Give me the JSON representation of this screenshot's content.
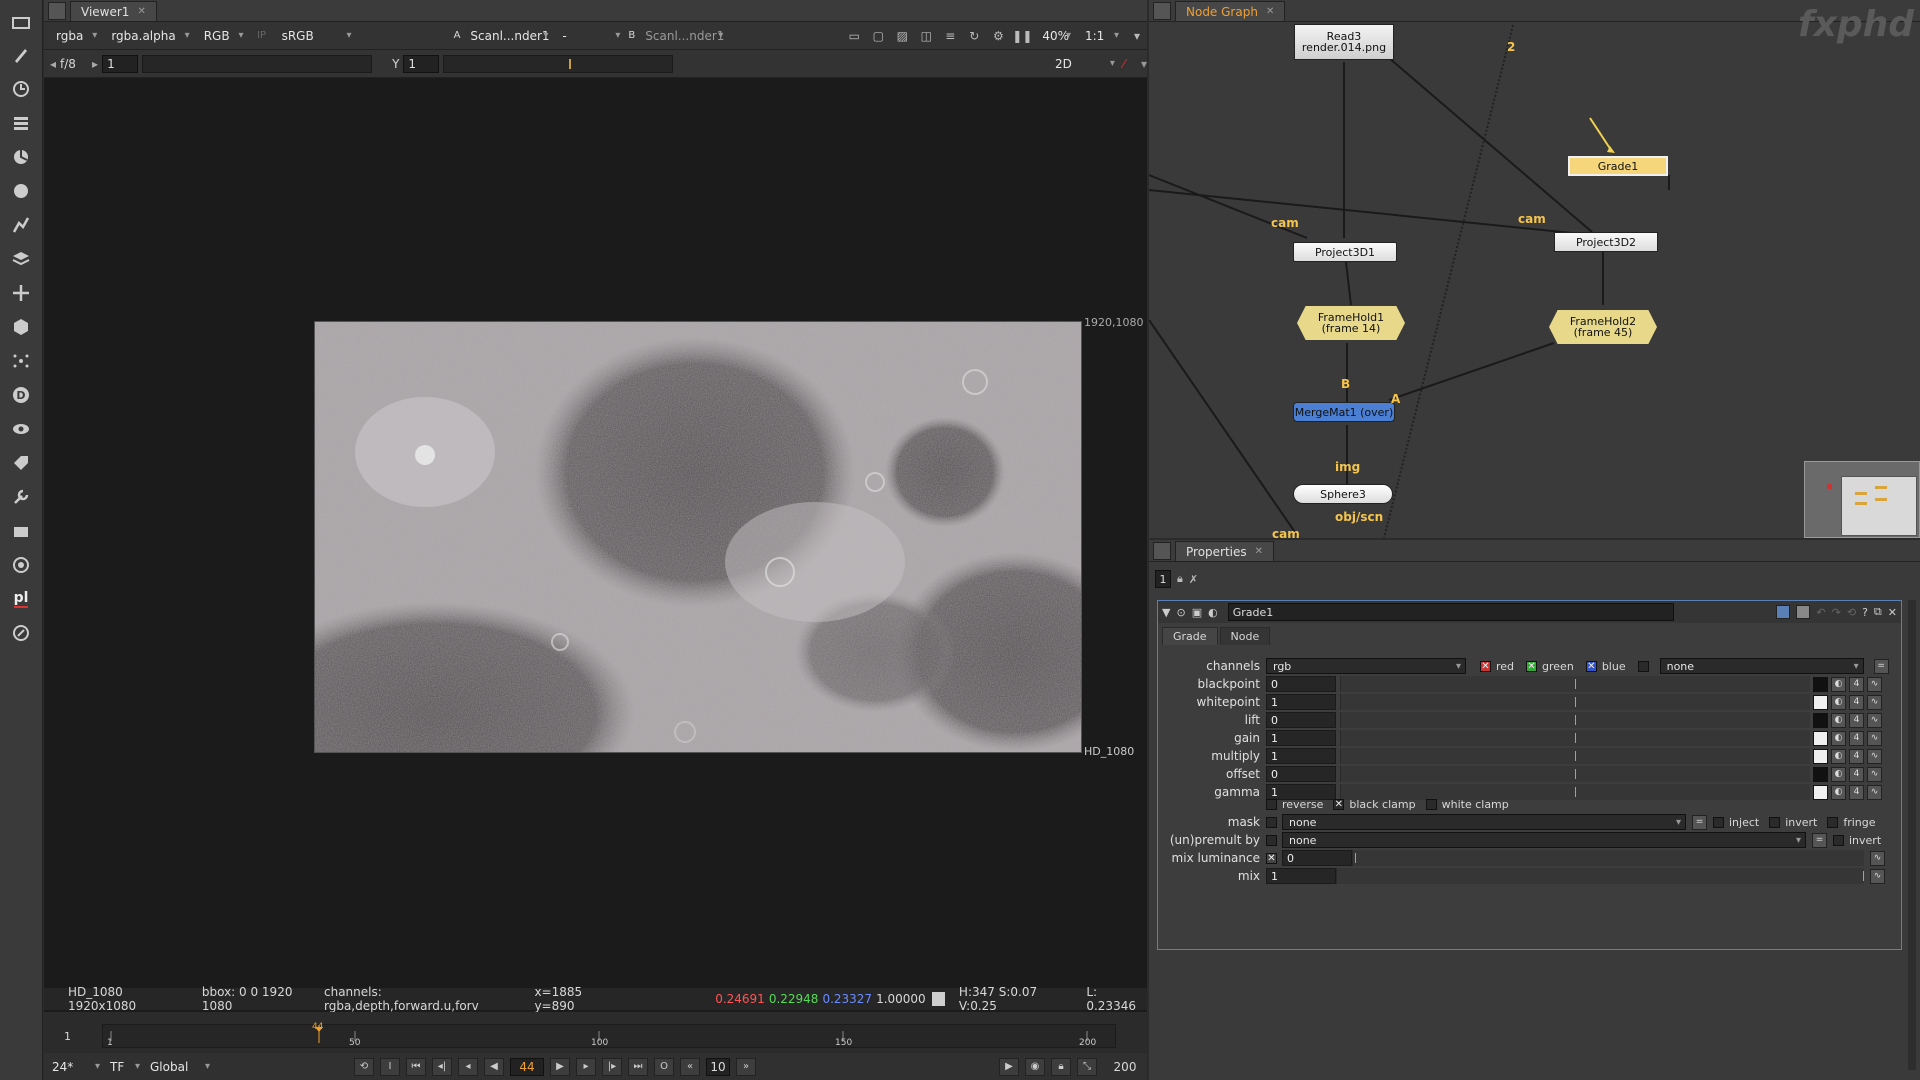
{
  "toolbar": {
    "icons": [
      "viewer-toggle-icon",
      "paint-brush-icon",
      "clock-icon",
      "channel-layers-icon",
      "color-wheel-icon",
      "filter-circle-icon",
      "keyer-icon",
      "merge-stack-icon",
      "transform-move-icon",
      "3d-cube-icon",
      "particles-icon",
      "deep-icon",
      "views-eye-icon",
      "metadata-tag-icon",
      "toolsets-wrench-icon",
      "other-drawer-icon",
      "furnace-icon",
      "pl-plugin-icon",
      "nukex-icon"
    ],
    "pl_label": "pl"
  },
  "viewer": {
    "tab_label": "Viewer1",
    "channels": "rgba",
    "alpha": "rgba.alpha",
    "display": "RGB",
    "ip": "IP",
    "lut": "sRGB",
    "input_a_label": "A",
    "input_a": "Scanl...nder1",
    "wipe": "-",
    "input_b_label": "B",
    "input_b": "Scanl...nder1",
    "zoom": "40%",
    "ratio": "1:1",
    "fstop": "f/8",
    "gain_val": "1",
    "gamma_label": "Y",
    "gamma_val": "1",
    "mode": "2D",
    "format_top": "1920,1080",
    "format_bottom": "HD_1080",
    "status": {
      "format": "HD_1080 1920x1080",
      "bbox": "bbox: 0 0 1920 1080",
      "channels": "channels: rgba,depth,forward.u,forv",
      "coords": "x=1885 y=890",
      "r": "0.24691",
      "g": "0.22948",
      "b": "0.23327",
      "a": "1.00000",
      "hsv": "H:347 S:0.07 V:0.25",
      "lum": "L: 0.23346",
      "r_color": "#ff5555",
      "g_color": "#55dd55",
      "b_color": "#6a8cff"
    },
    "timeline": {
      "start": "1",
      "end": "200",
      "ticks": [
        "1",
        "50",
        "100",
        "150",
        "200"
      ],
      "current": "44"
    },
    "transport": {
      "fps": "24*",
      "tf": "TF",
      "scope": "Global",
      "frame": "44",
      "step": "10",
      "end_frame": "200",
      "in_label": "I",
      "out_label": "O"
    }
  },
  "nodegraph": {
    "tab_label": "Node Graph",
    "watermark": "fxphd",
    "nodes": {
      "read3": "Read3\nrender.014.png",
      "grade1": "Grade1",
      "project3d1": "Project3D1",
      "project3d2": "Project3D2",
      "framehold1": "FrameHold1\n(frame 14)",
      "framehold2": "FrameHold2\n(frame 45)",
      "mergemat": "MergeMat1 (over)",
      "sphere3": "Sphere3"
    },
    "labels": {
      "cam1": "cam",
      "cam2": "cam",
      "cam3": "cam",
      "b": "B",
      "a": "A",
      "img": "img",
      "objscn": "obj/scn",
      "two": "2"
    }
  },
  "properties": {
    "tab_label": "Properties",
    "count": "1",
    "node_name": "Grade1",
    "tabs": [
      "Grade",
      "Node"
    ],
    "channels_label": "channels",
    "channels_value": "rgb",
    "ch_red": "red",
    "ch_green": "green",
    "ch_blue": "blue",
    "ch_extra": "none",
    "params": [
      {
        "label": "blackpoint",
        "value": "0"
      },
      {
        "label": "whitepoint",
        "value": "1"
      },
      {
        "label": "lift",
        "value": "0"
      },
      {
        "label": "gain",
        "value": "1"
      },
      {
        "label": "multiply",
        "value": "1"
      },
      {
        "label": "offset",
        "value": "0"
      },
      {
        "label": "gamma",
        "value": "1"
      }
    ],
    "reverse": "reverse",
    "black_clamp": "black clamp",
    "white_clamp": "white clamp",
    "mask_label": "mask",
    "mask_value": "none",
    "inject": "inject",
    "invert": "invert",
    "fringe": "fringe",
    "premult_label": "(un)premult by",
    "premult_value": "none",
    "invert2": "invert",
    "mixlum_label": "mix luminance",
    "mixlum_value": "0",
    "mix_label": "mix",
    "mix_value": "1",
    "slider_ticks": [
      "-1",
      "-0.8",
      "-0.6",
      "-0.4",
      "-0.2",
      "0",
      "0.2",
      "0.4",
      "0.6",
      "0.8",
      "1"
    ],
    "colors": {
      "accent": "#f0a030",
      "node_grade": "#f5d67a",
      "node_framehold": "#e8d98a",
      "node_merge": "#4a7fd4",
      "node_project": "#e8e8e8"
    }
  }
}
